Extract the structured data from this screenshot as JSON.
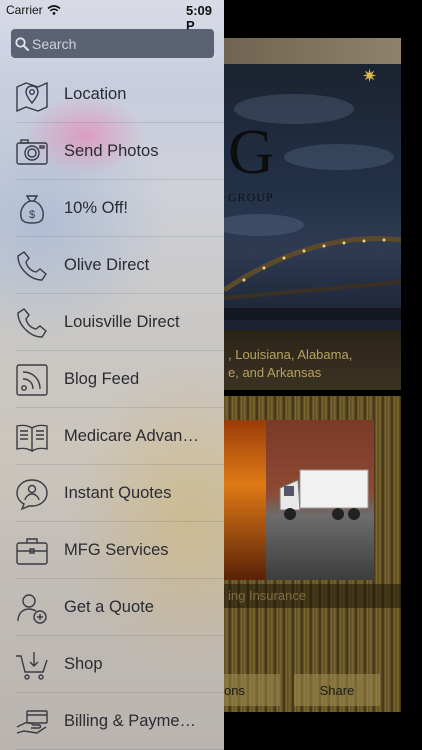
{
  "status": {
    "carrier": "Carrier",
    "time": "5:09 P"
  },
  "search": {
    "placeholder": "Search"
  },
  "menu": [
    {
      "label": "Location",
      "icon": "map-icon"
    },
    {
      "label": "Send Photos",
      "icon": "camera-icon"
    },
    {
      "label": "10% Off!",
      "icon": "money-bag-icon"
    },
    {
      "label": "Olive Direct",
      "icon": "phone-icon"
    },
    {
      "label": "Louisville Direct",
      "icon": "phone-icon"
    },
    {
      "label": "Blog Feed",
      "icon": "rss-icon"
    },
    {
      "label": "Medicare Advan…",
      "icon": "book-icon"
    },
    {
      "label": "Instant Quotes",
      "icon": "chat-user-icon"
    },
    {
      "label": "MFG Services",
      "icon": "briefcase-icon"
    },
    {
      "label": "Get a Quote",
      "icon": "add-user-icon"
    },
    {
      "label": "Shop",
      "icon": "cart-icon"
    },
    {
      "label": "Billing & Payme…",
      "icon": "payment-hand-icon"
    }
  ],
  "background": {
    "logo_letter": "G",
    "logo_sub": "GROUP",
    "banner_text": ", Louisiana, Alabama,\ne, and Arkansas",
    "caption": "ing Insurance",
    "left_button": "ons",
    "share_button": "Share"
  }
}
